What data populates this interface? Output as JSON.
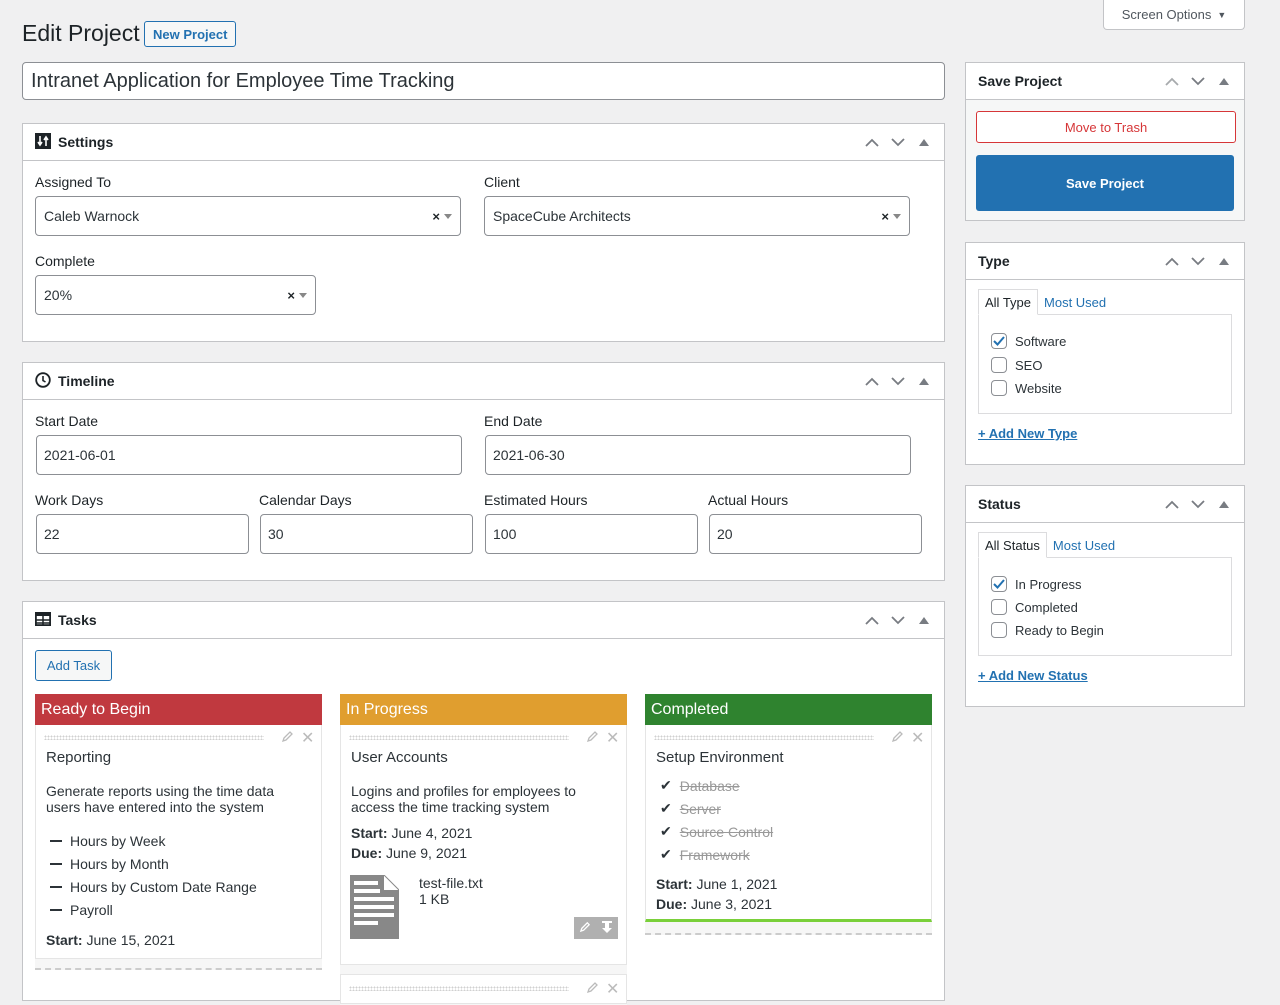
{
  "header": {
    "screen_options": "Screen Options",
    "page_title": "Edit Project",
    "new_project_label": "New Project",
    "project_title": "Intranet Application for Employee Time Tracking"
  },
  "settings": {
    "title": "Settings",
    "assigned_to_label": "Assigned To",
    "assigned_to_value": "Caleb Warnock",
    "client_label": "Client",
    "client_value": "SpaceCube Architects",
    "complete_label": "Complete",
    "complete_value": "20%"
  },
  "timeline": {
    "title": "Timeline",
    "start_date_label": "Start Date",
    "start_date_value": "2021-06-01",
    "end_date_label": "End Date",
    "end_date_value": "2021-06-30",
    "work_days_label": "Work Days",
    "work_days_value": "22",
    "calendar_days_label": "Calendar Days",
    "calendar_days_value": "30",
    "estimated_hours_label": "Estimated Hours",
    "estimated_hours_value": "100",
    "actual_hours_label": "Actual Hours",
    "actual_hours_value": "20"
  },
  "tasks": {
    "title": "Tasks",
    "add_task_label": "Add Task",
    "columns": [
      {
        "name": "Ready to Begin",
        "color": "#c0393f",
        "cards": [
          {
            "title": "Reporting",
            "description": "Generate reports using the time data users have entered into the system",
            "items": [
              "Hours by Week",
              "Hours by Month",
              "Hours by Custom Date Range",
              "Payroll"
            ],
            "start_label": "Start:",
            "start": "June 15, 2021"
          }
        ]
      },
      {
        "name": "In Progress",
        "color": "#e09e2f",
        "cards": [
          {
            "title": "User Accounts",
            "description": "Logins and profiles for employees to access the time tracking system",
            "start_label": "Start:",
            "start": "June 4, 2021",
            "due_label": "Due:",
            "due": "June 9, 2021",
            "attachment": {
              "name": "test-file.txt",
              "size": "1 KB"
            }
          }
        ]
      },
      {
        "name": "Completed",
        "color": "#2f832f",
        "progress_color": "#7ad03a",
        "cards": [
          {
            "title": "Setup Environment",
            "checklist": [
              "Database",
              "Server",
              "Source Control",
              "Framework"
            ],
            "start_label": "Start:",
            "start": "June 1, 2021",
            "due_label": "Due:",
            "due": "June 3, 2021"
          }
        ]
      }
    ]
  },
  "save_box": {
    "title": "Save Project",
    "trash_label": "Move to Trash",
    "save_label": "Save Project"
  },
  "type_box": {
    "title": "Type",
    "tab_all": "All Type",
    "tab_most_used": "Most Used",
    "options": [
      {
        "label": "Software",
        "checked": true
      },
      {
        "label": "SEO",
        "checked": false
      },
      {
        "label": "Website",
        "checked": false
      }
    ],
    "add_new": "+ Add New Type"
  },
  "status_box": {
    "title": "Status",
    "tab_all": "All Status",
    "tab_most_used": "Most Used",
    "options": [
      {
        "label": "In Progress",
        "checked": true
      },
      {
        "label": "Completed",
        "checked": false
      },
      {
        "label": "Ready to Begin",
        "checked": false
      }
    ],
    "add_new": "+ Add New Status"
  },
  "colors": {
    "accent": "#2271b1",
    "danger": "#d63638"
  }
}
